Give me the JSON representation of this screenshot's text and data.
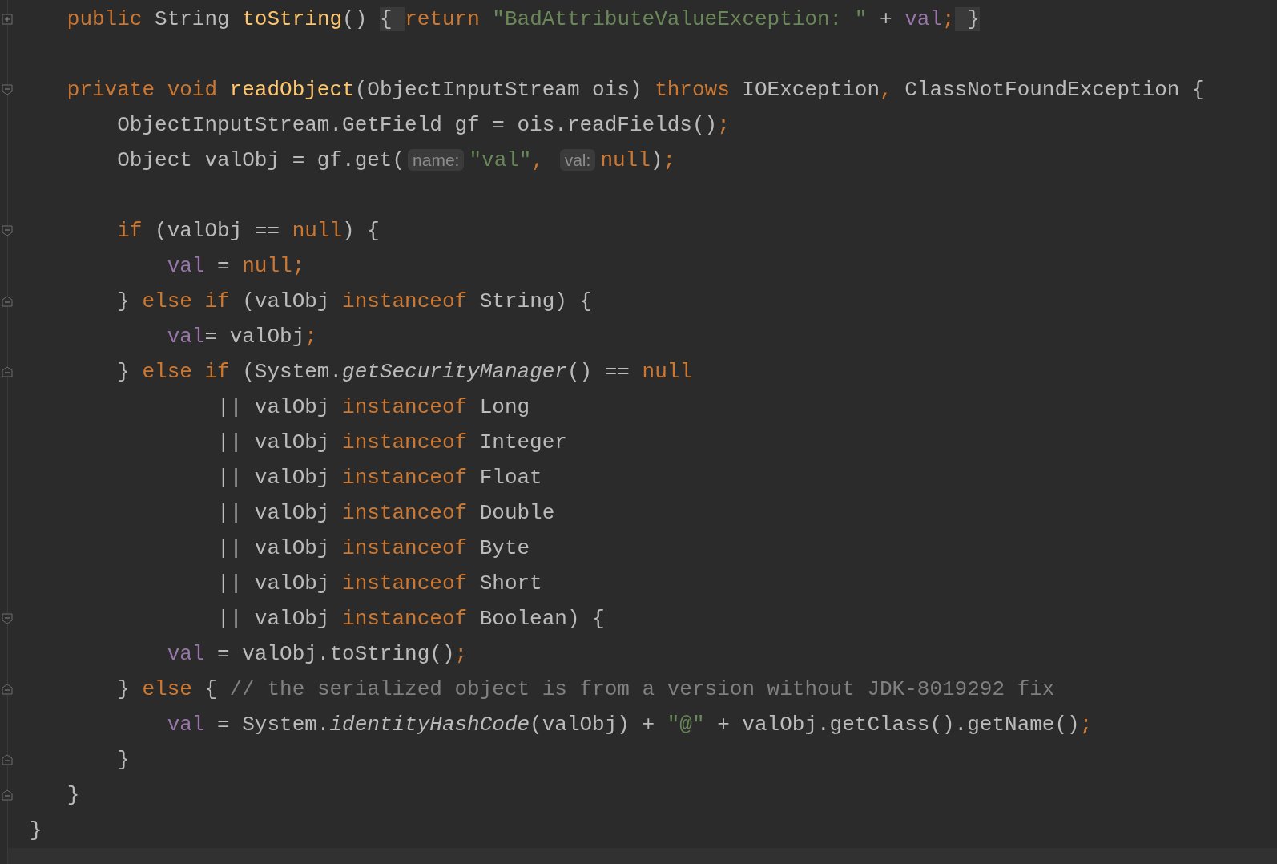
{
  "editor": {
    "lines": [
      {
        "gutter_icon": {
          "kind": "plus"
        },
        "blank_line_after": true,
        "tokens": [
          {
            "text": "   public",
            "kind": "k"
          },
          {
            "text": " String ",
            "kind": "p"
          },
          {
            "text": "toString",
            "kind": "fn"
          },
          {
            "text": "() ",
            "kind": "p"
          },
          {
            "text": "{ ",
            "kind": "fold"
          },
          {
            "text": "return",
            "kind": "k"
          },
          {
            "text": " \"BadAttributeValueException: \"",
            "kind": "s"
          },
          {
            "text": " + ",
            "kind": "p"
          },
          {
            "text": "val",
            "kind": "f"
          },
          {
            "text": ";",
            "kind": "k"
          },
          {
            "text": " }",
            "kind": "fold"
          }
        ]
      },
      {
        "gutter_icon": {
          "kind": "start"
        },
        "tokens": [
          {
            "text": "   private void ",
            "kind": "k"
          },
          {
            "text": "readObject",
            "kind": "fn"
          },
          {
            "text": "(ObjectInputStream ois) ",
            "kind": "p"
          },
          {
            "text": "throws",
            "kind": "k"
          },
          {
            "text": " IOException",
            "kind": "p"
          },
          {
            "text": ",",
            "kind": "k"
          },
          {
            "text": " ClassNotFoundException {",
            "kind": "p"
          }
        ]
      },
      {
        "tokens": [
          {
            "text": "       ObjectInputStream.GetField gf = ois.readFields()",
            "kind": "p"
          },
          {
            "text": ";",
            "kind": "k"
          }
        ]
      },
      {
        "blank_line_after": true,
        "tokens": [
          {
            "text": "       Object valObj = gf.get(",
            "kind": "p"
          },
          {
            "text": "name:",
            "kind": "hint"
          },
          {
            "text": "\"val\"",
            "kind": "s"
          },
          {
            "text": ", ",
            "kind": "k"
          },
          {
            "text": "val:",
            "kind": "hint"
          },
          {
            "text": "null",
            "kind": "k"
          },
          {
            "text": ")",
            "kind": "p"
          },
          {
            "text": ";",
            "kind": "k"
          }
        ]
      },
      {
        "gutter_icon": {
          "kind": "start"
        },
        "tokens": [
          {
            "text": "       if",
            "kind": "k"
          },
          {
            "text": " (valObj == ",
            "kind": "p"
          },
          {
            "text": "null",
            "kind": "k"
          },
          {
            "text": ") {",
            "kind": "p"
          }
        ]
      },
      {
        "tokens": [
          {
            "text": "           val",
            "kind": "f"
          },
          {
            "text": " = ",
            "kind": "p"
          },
          {
            "text": "null;",
            "kind": "k"
          }
        ]
      },
      {
        "gutter_icon": {
          "kind": "end"
        },
        "tokens": [
          {
            "text": "       } ",
            "kind": "p"
          },
          {
            "text": "else if",
            "kind": "k"
          },
          {
            "text": " (valObj ",
            "kind": "p"
          },
          {
            "text": "instanceof",
            "kind": "k"
          },
          {
            "text": " String) {",
            "kind": "p"
          }
        ]
      },
      {
        "tokens": [
          {
            "text": "           val",
            "kind": "f"
          },
          {
            "text": "= valObj",
            "kind": "p"
          },
          {
            "text": ";",
            "kind": "k"
          }
        ]
      },
      {
        "gutter_icon": {
          "kind": "end"
        },
        "tokens": [
          {
            "text": "       } ",
            "kind": "p"
          },
          {
            "text": "else if",
            "kind": "k"
          },
          {
            "text": " (System.",
            "kind": "p"
          },
          {
            "text": "getSecurityManager",
            "kind": "i"
          },
          {
            "text": "() == ",
            "kind": "p"
          },
          {
            "text": "null",
            "kind": "k"
          }
        ]
      },
      {
        "tokens": [
          {
            "text": "               || valObj ",
            "kind": "p"
          },
          {
            "text": "instanceof",
            "kind": "k"
          },
          {
            "text": " Long",
            "kind": "p"
          }
        ]
      },
      {
        "tokens": [
          {
            "text": "               || valObj ",
            "kind": "p"
          },
          {
            "text": "instanceof",
            "kind": "k"
          },
          {
            "text": " Integer",
            "kind": "p"
          }
        ]
      },
      {
        "tokens": [
          {
            "text": "               || valObj ",
            "kind": "p"
          },
          {
            "text": "instanceof",
            "kind": "k"
          },
          {
            "text": " Float",
            "kind": "p"
          }
        ]
      },
      {
        "tokens": [
          {
            "text": "               || valObj ",
            "kind": "p"
          },
          {
            "text": "instanceof",
            "kind": "k"
          },
          {
            "text": " Double",
            "kind": "p"
          }
        ]
      },
      {
        "tokens": [
          {
            "text": "               || valObj ",
            "kind": "p"
          },
          {
            "text": "instanceof",
            "kind": "k"
          },
          {
            "text": " Byte",
            "kind": "p"
          }
        ]
      },
      {
        "tokens": [
          {
            "text": "               || valObj ",
            "kind": "p"
          },
          {
            "text": "instanceof",
            "kind": "k"
          },
          {
            "text": " Short",
            "kind": "p"
          }
        ]
      },
      {
        "gutter_icon": {
          "kind": "start"
        },
        "tokens": [
          {
            "text": "               || valObj ",
            "kind": "p"
          },
          {
            "text": "instanceof",
            "kind": "k"
          },
          {
            "text": " Boolean) {",
            "kind": "p"
          }
        ]
      },
      {
        "tokens": [
          {
            "text": "           val",
            "kind": "f"
          },
          {
            "text": " = valObj.toString()",
            "kind": "p"
          },
          {
            "text": ";",
            "kind": "k"
          }
        ]
      },
      {
        "gutter_icon": {
          "kind": "end"
        },
        "tokens": [
          {
            "text": "       } ",
            "kind": "p"
          },
          {
            "text": "else",
            "kind": "k"
          },
          {
            "text": " { ",
            "kind": "p"
          },
          {
            "text": "// the serialized object is from a version without JDK-8019292 fix",
            "kind": "c"
          }
        ]
      },
      {
        "tokens": [
          {
            "text": "           val",
            "kind": "f"
          },
          {
            "text": " = System.",
            "kind": "p"
          },
          {
            "text": "identityHashCode",
            "kind": "i"
          },
          {
            "text": "(valObj) + ",
            "kind": "p"
          },
          {
            "text": "\"@\"",
            "kind": "s"
          },
          {
            "text": " + valObj.getClass().getName()",
            "kind": "p"
          },
          {
            "text": ";",
            "kind": "k"
          }
        ]
      },
      {
        "gutter_icon": {
          "kind": "end"
        },
        "tokens": [
          {
            "text": "       }",
            "kind": "p"
          }
        ]
      },
      {
        "gutter_icon": {
          "kind": "end"
        },
        "tokens": [
          {
            "text": "   }",
            "kind": "p"
          }
        ]
      },
      {
        "tokens": [
          {
            "text": "}",
            "kind": "p"
          }
        ]
      }
    ]
  }
}
